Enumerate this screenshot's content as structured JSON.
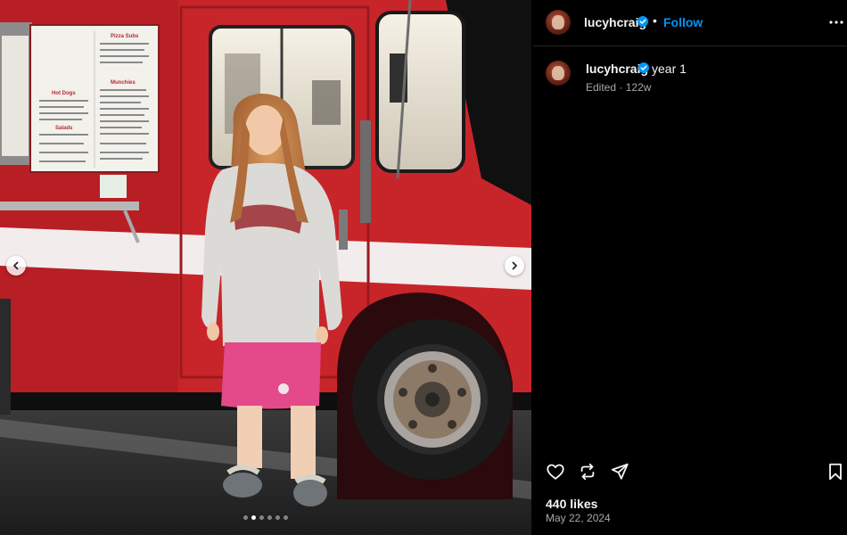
{
  "post": {
    "username": "lucyhcraig",
    "follow_label": "Follow",
    "separator": "•",
    "caption": "year 1",
    "edited_label": "Edited",
    "age": "122w",
    "likes": "440 likes",
    "date": "May 22, 2024"
  },
  "media": {
    "alt": "Photo of a person standing in front of a red food truck at night",
    "menu_sections": [
      "Pizza Subs",
      "Hot Dogs",
      "Salads",
      "Munchies"
    ],
    "slide_count": 6,
    "active_slide": 2
  },
  "icons": {
    "verified": "verified-badge-icon",
    "more": "more-options-icon",
    "like": "heart-icon",
    "comment": "comment-icon",
    "share": "share-icon",
    "save": "bookmark-icon",
    "prev": "chevron-left-icon",
    "next": "chevron-right-icon"
  },
  "colors": {
    "accent": "#0095f6",
    "background": "#000000",
    "truck_red": "#c8252a",
    "muted_text": "#a8a8a8"
  }
}
